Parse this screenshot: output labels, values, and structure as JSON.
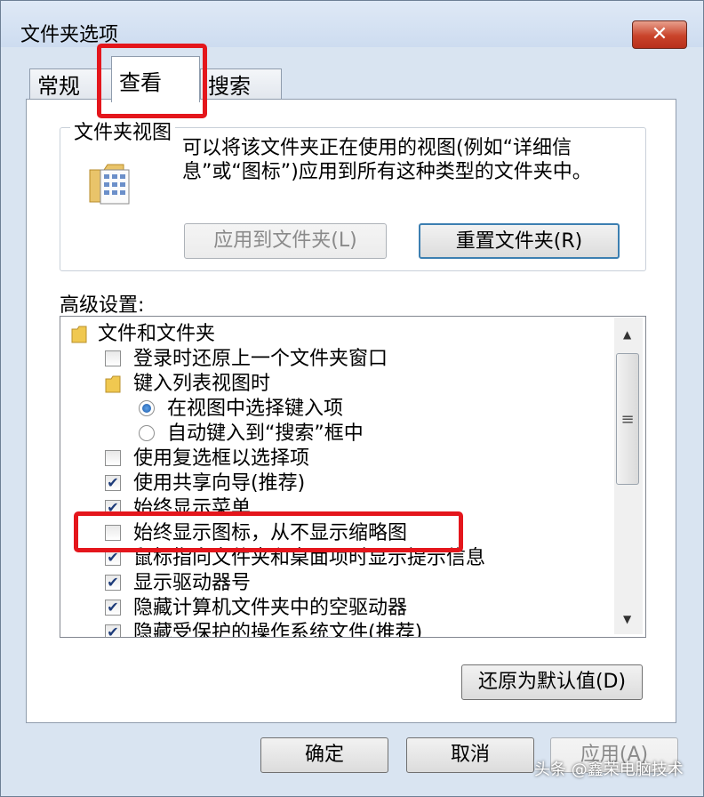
{
  "window": {
    "title": "文件夹选项",
    "close_label": "✕"
  },
  "tabs": [
    {
      "label": "常规"
    },
    {
      "label": "查看"
    },
    {
      "label": "搜索"
    }
  ],
  "folder_views": {
    "group_title": "文件夹视图",
    "description": "可以将该文件夹正在使用的视图(例如“详细信息”或“图标”)应用到所有这种类型的文件夹中。",
    "apply_button": "应用到文件夹(L)",
    "reset_button": "重置文件夹(R)"
  },
  "advanced": {
    "label": "高级设置:",
    "items": [
      {
        "kind": "folder",
        "label": "文件和文件夹"
      },
      {
        "kind": "checkbox",
        "checked": false,
        "label": "登录时还原上一个文件夹窗口"
      },
      {
        "kind": "folder",
        "label": "键入列表视图时"
      },
      {
        "kind": "radio",
        "checked": true,
        "label": "在视图中选择键入项"
      },
      {
        "kind": "radio",
        "checked": false,
        "label": "自动键入到“搜索”框中"
      },
      {
        "kind": "checkbox",
        "checked": false,
        "label": "使用复选框以选择项"
      },
      {
        "kind": "checkbox",
        "checked": true,
        "label": "使用共享向导(推荐)"
      },
      {
        "kind": "checkbox",
        "checked": true,
        "label": "始终显示菜单"
      },
      {
        "kind": "checkbox",
        "checked": false,
        "label": "始终显示图标，从不显示缩略图"
      },
      {
        "kind": "checkbox",
        "checked": true,
        "label": "鼠标指向文件夹和桌面项时显示提示信息"
      },
      {
        "kind": "checkbox",
        "checked": true,
        "label": "显示驱动器号"
      },
      {
        "kind": "checkbox",
        "checked": true,
        "label": "隐藏计算机文件夹中的空驱动器"
      },
      {
        "kind": "checkbox",
        "checked": true,
        "label": "隐藏受保护的操作系统文件(推荐)"
      }
    ],
    "restore_button": "还原为默认值(D)"
  },
  "footer": {
    "ok": "确定",
    "cancel": "取消",
    "apply": "应用(A)"
  },
  "watermark": "头条 @鑫荣电脑技术"
}
